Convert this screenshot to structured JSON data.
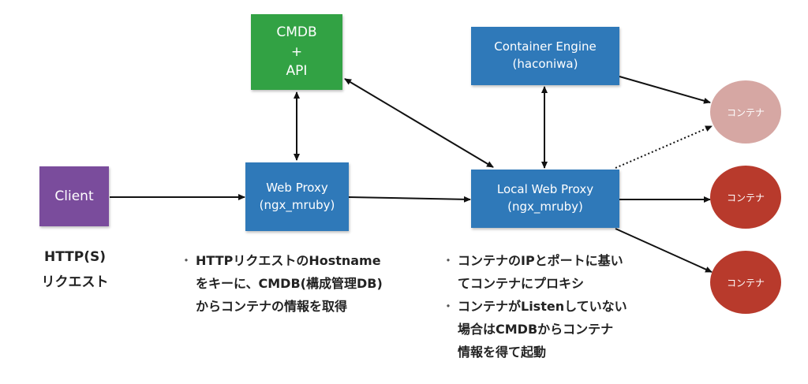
{
  "colors": {
    "blue": "#2f79b9",
    "green": "#32a244",
    "purple": "#7a4c9c",
    "container_red": "#b83a2c",
    "container_faded": "#d6a7a3",
    "arrow": "#111111"
  },
  "boxes": {
    "cmdb": {
      "lines": [
        "CMDB",
        "+",
        "API"
      ]
    },
    "container_engine": {
      "lines": [
        "Container Engine",
        "(haconiwa)"
      ]
    },
    "client": {
      "label": "Client"
    },
    "web_proxy": {
      "lines": [
        "Web Proxy",
        "(ngx_mruby)"
      ]
    },
    "local_web_proxy": {
      "lines": [
        "Local Web Proxy",
        "(ngx_mruby)"
      ]
    }
  },
  "containers": [
    {
      "label": "コンテナ",
      "state": "faded"
    },
    {
      "label": "コンテナ",
      "state": "active"
    },
    {
      "label": "コンテナ",
      "state": "active"
    }
  ],
  "notes": {
    "client": {
      "lines": [
        "HTTP(S)",
        "リクエスト"
      ]
    },
    "web_proxy": {
      "bullet": "・",
      "lines": [
        "HTTPリクエストのHostname",
        "をキーに、CMDB(構成管理DB)",
        "からコンテナの情報を取得"
      ]
    },
    "local_proxy": {
      "bullet": "・",
      "items": [
        {
          "lines": [
            "コンテナのIPとポートに基い",
            "てコンテナにプロキシ"
          ]
        },
        {
          "lines": [
            "コンテナがListenしていない",
            "場合はCMDBからコンテナ",
            "情報を得て起動"
          ]
        }
      ]
    }
  }
}
